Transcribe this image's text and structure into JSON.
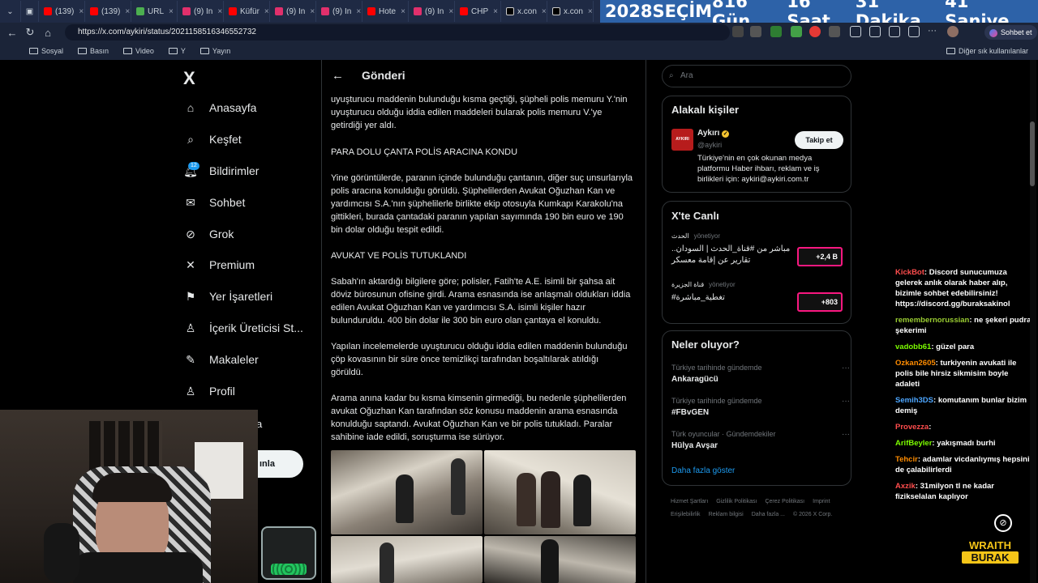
{
  "browser": {
    "tabs": [
      {
        "label": "(139)",
        "color": "#ff0000"
      },
      {
        "label": "(139)",
        "color": "#ff0000"
      },
      {
        "label": "URL",
        "color": "#4caf50"
      },
      {
        "label": "(9) In",
        "color": "#e1306c"
      },
      {
        "label": "Küfür",
        "color": "#ff0000"
      },
      {
        "label": "(9) In",
        "color": "#e1306c"
      },
      {
        "label": "(9) In",
        "color": "#e1306c"
      },
      {
        "label": "Hote",
        "color": "#ff0000"
      },
      {
        "label": "(9) In",
        "color": "#e1306c"
      },
      {
        "label": "CHP",
        "color": "#ff0000"
      },
      {
        "label": "x.con",
        "color": "#000000"
      },
      {
        "label": "x.con",
        "color": "#000000"
      }
    ],
    "url": "https://x.com/aykiri/status/2021158516346552732",
    "chat_button": "Sohbet et",
    "bookmarks": [
      "Sosyal",
      "Basın",
      "Video",
      "Y",
      "Yayın"
    ],
    "other_bookmarks": "Diğer sık kullanılanlar"
  },
  "countdown": {
    "year": "2028",
    "label": "SEÇİM",
    "days": "816 Gün",
    "hours": "16 Saat",
    "minutes": "31 Dakika",
    "seconds": "41 Saniye"
  },
  "sidebar": {
    "logo": "X",
    "notification_count": "12",
    "items": [
      {
        "label": "Anasayfa",
        "icon": "home-icon"
      },
      {
        "label": "Keşfet",
        "icon": "search-icon"
      },
      {
        "label": "Bildirimler",
        "icon": "bell-icon"
      },
      {
        "label": "Sohbet",
        "icon": "mail-icon"
      },
      {
        "label": "Grok",
        "icon": "grok-icon"
      },
      {
        "label": "Premium",
        "icon": "x-icon"
      },
      {
        "label": "Yer İşaretleri",
        "icon": "bookmark-icon"
      },
      {
        "label": "İçerik Üreticisi St...",
        "icon": "creator-icon"
      },
      {
        "label": "Makaleler",
        "icon": "article-icon"
      },
      {
        "label": "Profil",
        "icon": "profile-icon"
      }
    ],
    "more_fragment": "a",
    "post_button_fragment": "ınla"
  },
  "post": {
    "header": "Gönderi",
    "paragraphs": [
      "uyuşturucu maddenin bulunduğu kısma geçtiği, şüpheli polis memuru Y.'nin uyuşturucu olduğu iddia edilen maddeleri bularak polis memuru V.'ye getirdiği yer aldı.",
      "PARA DOLU ÇANTA POLİS ARACINA KONDU",
      "Yine görüntülerde, paranın içinde bulunduğu çantanın, diğer suç unsurlarıyla polis aracına konulduğu görüldü. Şüphelilerden Avukat Oğuzhan Kan ve yardımcısı S.A.'nın şüphelilerle birlikte ekip otosuyla Kumkapı Karakolu'na gittikleri, burada çantadaki paranın yapılan sayımında 190 bin euro ve 190 bin dolar olduğu tespit edildi.",
      "AVUKAT VE POLİS TUTUKLANDI",
      "Sabah'ın aktardığı bilgilere göre; polisler, Fatih'te A.E. isimli bir şahsa ait döviz bürosunun ofisine girdi. Arama esnasında ise anlaşmalı oldukları iddia edilen Avukat Oğuzhan Kan ve yardımcısı S.A. isimli kişiler hazır bulunduruldu. 400 bin dolar ile 300 bin euro olan çantaya el konuldu.",
      "Yapılan incelemelerde uyuşturucu olduğu iddia edilen maddenin bulunduğu çöp kovasının bir süre önce temizlikçi tarafından boşaltılarak atıldığı görüldü.",
      "Arama anına kadar bu kısma kimsenin girmediği, bu nedenle şüphelilerden avukat Oğuzhan Kan tarafından söz konusu maddenin arama esnasında konulduğu saptandı. Avukat Oğuzhan Kan ve bir polis tutukladı. Paralar sahibine iade edildi, soruşturma ise sürüyor."
    ]
  },
  "right": {
    "search_placeholder": "Ara",
    "related": {
      "title": "Alakalı kişiler",
      "name": "Aykırı",
      "handle": "@aykiri",
      "bio": "Türkiye'nin en çok okunan medya platformu Haber ihbarı, reklam ve iş birlikleri için: aykiri@aykiri.com.tr",
      "follow_label": "Takip et",
      "avatar_text": "AYKIRI"
    },
    "live": {
      "title": "X'te Canlı",
      "items": [
        {
          "host": "الحدث",
          "role": "yönetiyor",
          "text": "مباشر من #قناة_الحدث | السودان.. تقارير عن إقامة معسكر",
          "count": "+2,4 B"
        },
        {
          "host": "قناة الجزيرة",
          "role": "yönetiyor",
          "text": "تغطية_مباشرة#",
          "count": "+803"
        }
      ]
    },
    "trends": {
      "title": "Neler oluyor?",
      "items": [
        {
          "context": "Türkiye tarihinde gündemde",
          "name": "Ankaragücü"
        },
        {
          "context": "Türkiye tarihinde gündemde",
          "name": "#FBvGEN"
        },
        {
          "context": "Türk oyuncular · Gündemdekiler",
          "name": "Hülya Avşar"
        }
      ],
      "more": "Daha fazla göster"
    },
    "footer": [
      "Hizmet Şartları",
      "Gizlilik Politikası",
      "Çerez Politikası",
      "Imprint",
      "Erişilebilirlik",
      "Reklam bilgisi",
      "Daha fazla ...",
      "© 2026 X Corp."
    ]
  },
  "stream_chat": [
    {
      "user": "KickBot",
      "color": "#ff4d4d",
      "text": "Discord sunucumuza gelerek anlık olarak haber alıp, bizimle sohbet edebilirsiniz! https://discord.gg/buraksakinol"
    },
    {
      "user": "remembernorussian",
      "color": "#9acd32",
      "text": "ne şekeri pudra şekerimi"
    },
    {
      "user": "vadobb61",
      "color": "#7CFC00",
      "text": "güzel para"
    },
    {
      "user": "Ozkan2605",
      "color": "#ff8c00",
      "text": "turkiyenin avukati ile polis bile hirsiz sikmisim boyle adaleti"
    },
    {
      "user": "Semih3DS",
      "color": "#4da6ff",
      "text": "komutanım bunlar bizim demiş"
    },
    {
      "user": "Provezza",
      "color": "#ff4d4d",
      "text": ""
    },
    {
      "user": "ArifBeyler",
      "color": "#7CFC00",
      "text": "yakışmadı burhi"
    },
    {
      "user": "Tehcir",
      "color": "#ff8c00",
      "text": "adamlar vicdanlıymış hepsini de çalabilirlerdi"
    },
    {
      "user": "Axzik",
      "color": "#ff4d4d",
      "text": "31milyon tl ne kadar fizikselalan kaplıyor"
    }
  ],
  "stream_logo": {
    "line1": "WRAITH",
    "line2": "BURAK"
  }
}
